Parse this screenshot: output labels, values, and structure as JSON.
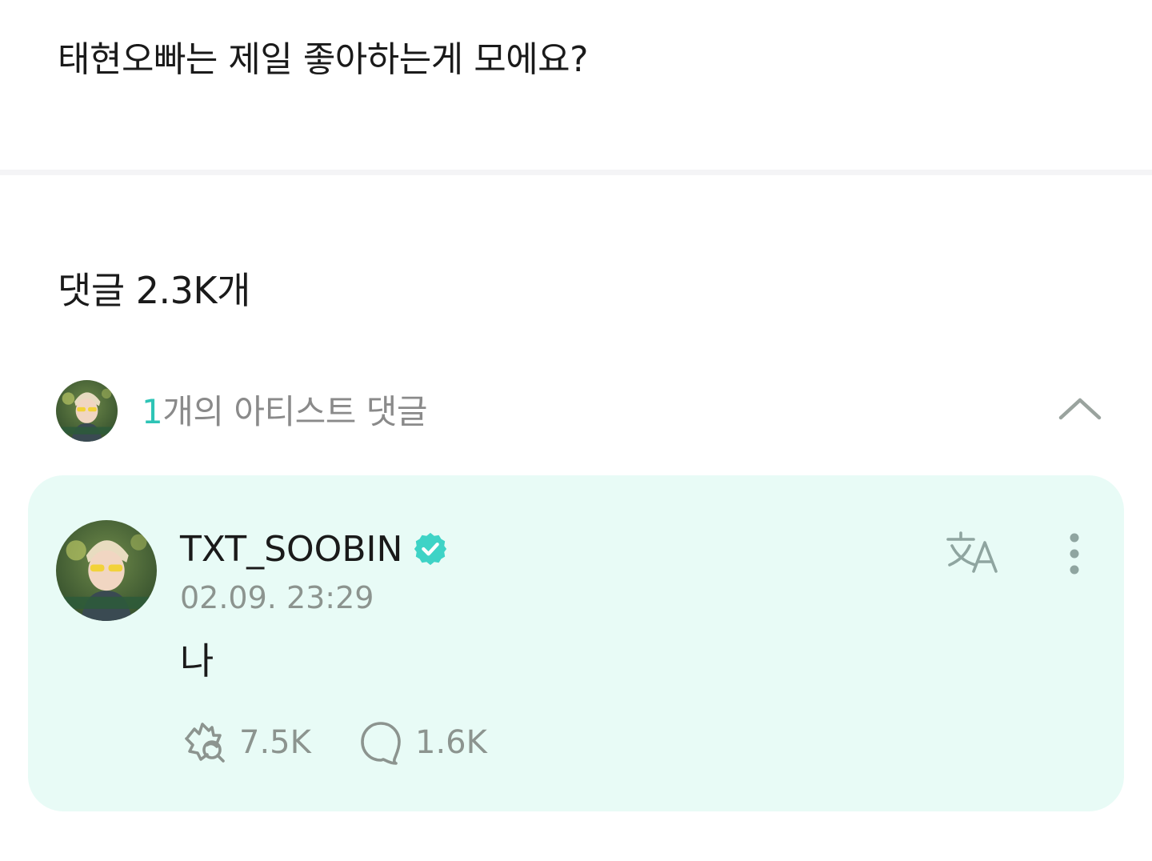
{
  "post": {
    "question": "태현오빠는 제일 좋아하는게 모에요?"
  },
  "comments": {
    "title": "댓글 2.3K개",
    "artist_summary": {
      "count": "1",
      "label": "개의 아티스트 댓글"
    }
  },
  "artist_comment": {
    "username": "TXT_SOOBIN",
    "timestamp": "02.09. 23:29",
    "text": "나",
    "likes": "7.5K",
    "replies": "1.6K"
  },
  "icons": {
    "verified": "verified-badge-icon",
    "translate": "translate-icon",
    "more": "more-vertical-icon",
    "collapse": "chevron-up-icon",
    "like": "cheer-hand-icon",
    "reply": "comment-bubble-icon"
  },
  "colors": {
    "accent": "#2ec4b6",
    "card_background": "#e8fbf6",
    "muted_text": "#8c948f",
    "verified_badge": "#3ed3c6"
  }
}
